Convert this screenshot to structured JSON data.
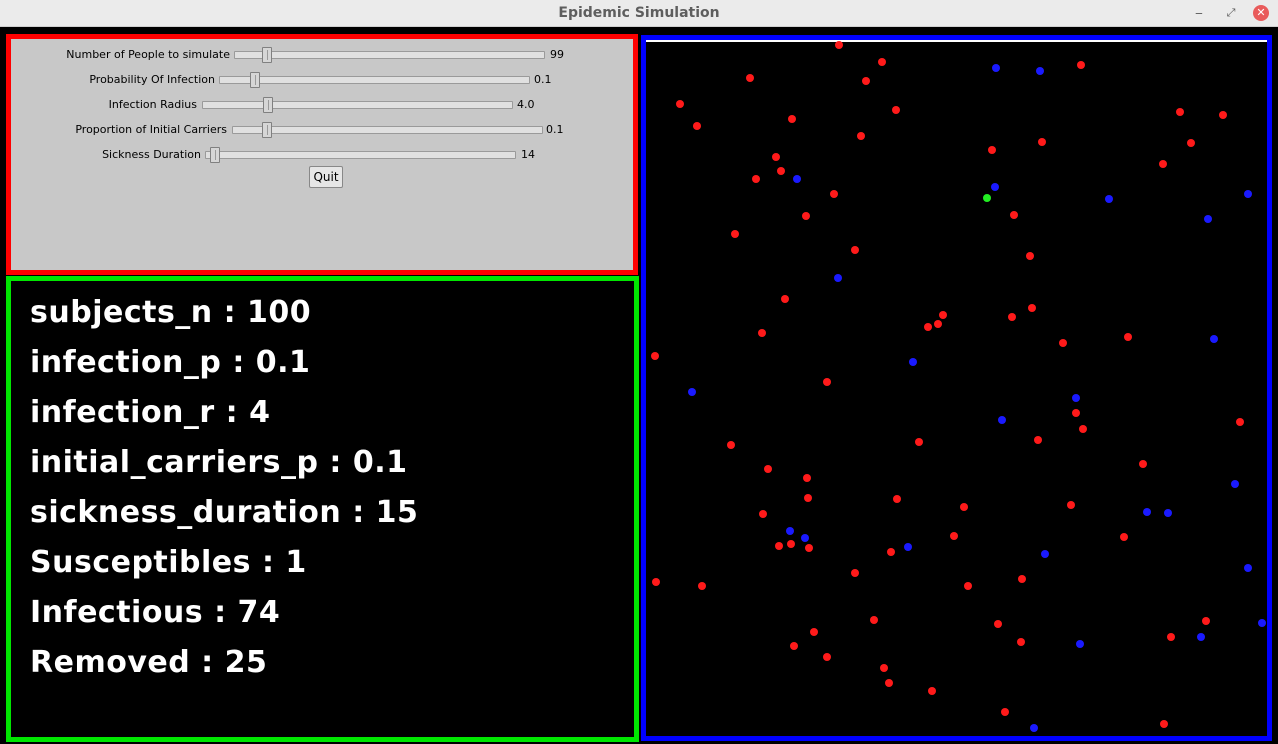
{
  "window": {
    "title": "Epidemic Simulation",
    "buttons": {
      "minimize": "‒",
      "maximize": "⤢",
      "close": "✕"
    }
  },
  "controls": {
    "sliders": [
      {
        "label": "Number of People to simulate",
        "value": "99"
      },
      {
        "label": "Probability Of Infection",
        "value": "0.1"
      },
      {
        "label": "Infection Radius",
        "value": "4.0"
      },
      {
        "label": "Proportion of Initial Carriers",
        "value": "0.1"
      },
      {
        "label": "Sickness Duration",
        "value": "14"
      }
    ],
    "quit_label": "Quit"
  },
  "stats": [
    {
      "text": "subjects_n : 100"
    },
    {
      "text": "infection_p : 0.1"
    },
    {
      "text": "infection_r : 4"
    },
    {
      "text": "initial_carriers_p : 0.1"
    },
    {
      "text": "sickness_duration : 15"
    },
    {
      "text": "Susceptibles : 1"
    },
    {
      "text": "Infectious : 74"
    },
    {
      "text": "Removed : 25"
    }
  ],
  "colors": {
    "controls_border": "#ff0000",
    "stats_border": "#00e600",
    "sim_border": "#0000ff",
    "infectious": "#ff1a1a",
    "removed": "#1a1aff",
    "susceptible": "#22ee22"
  }
}
